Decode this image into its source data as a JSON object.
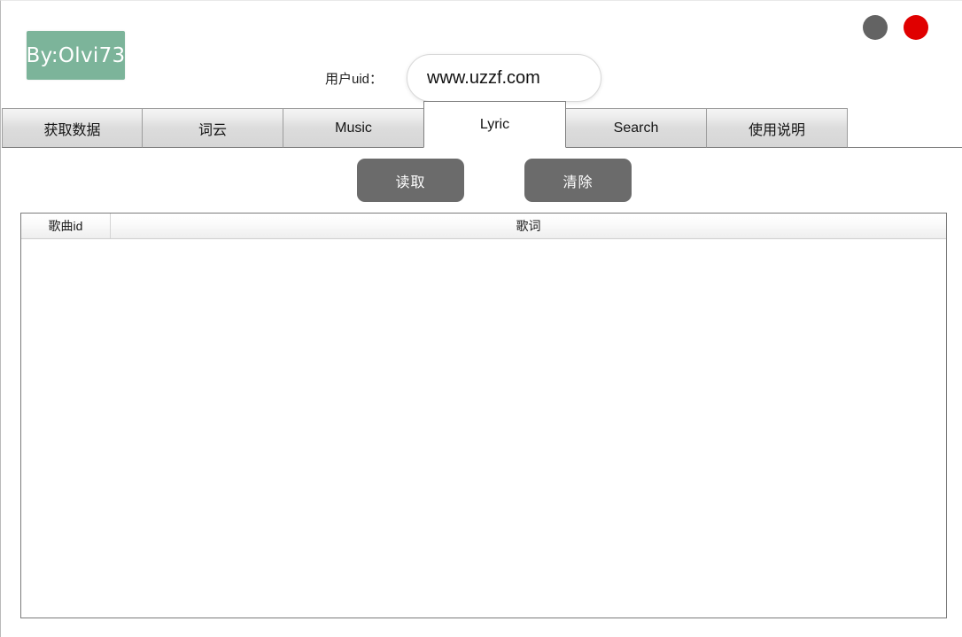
{
  "window": {
    "controls": [
      {
        "name": "minimize-button",
        "icon": "circle-gray",
        "color": "#636363",
        "label": ""
      },
      {
        "name": "close-button",
        "icon": "circle-red",
        "color": "#e00000",
        "label": ""
      }
    ]
  },
  "logo": {
    "text": "By:Olvi73",
    "background": "#7cb49a",
    "text_color": "#ffffff"
  },
  "uid": {
    "label": "用户uid：",
    "value": "www.uzzf.com",
    "placeholder": ""
  },
  "tabs": [
    {
      "label": "获取数据",
      "active": false
    },
    {
      "label": "词云",
      "active": false
    },
    {
      "label": "Music",
      "active": false
    },
    {
      "label": "Lyric",
      "active": true
    },
    {
      "label": "Search",
      "active": false
    },
    {
      "label": "使用说明",
      "active": false
    }
  ],
  "buttons": {
    "read": "读取",
    "clear": "清除"
  },
  "table": {
    "columns": [
      "歌曲id",
      "歌词"
    ],
    "rows": []
  }
}
